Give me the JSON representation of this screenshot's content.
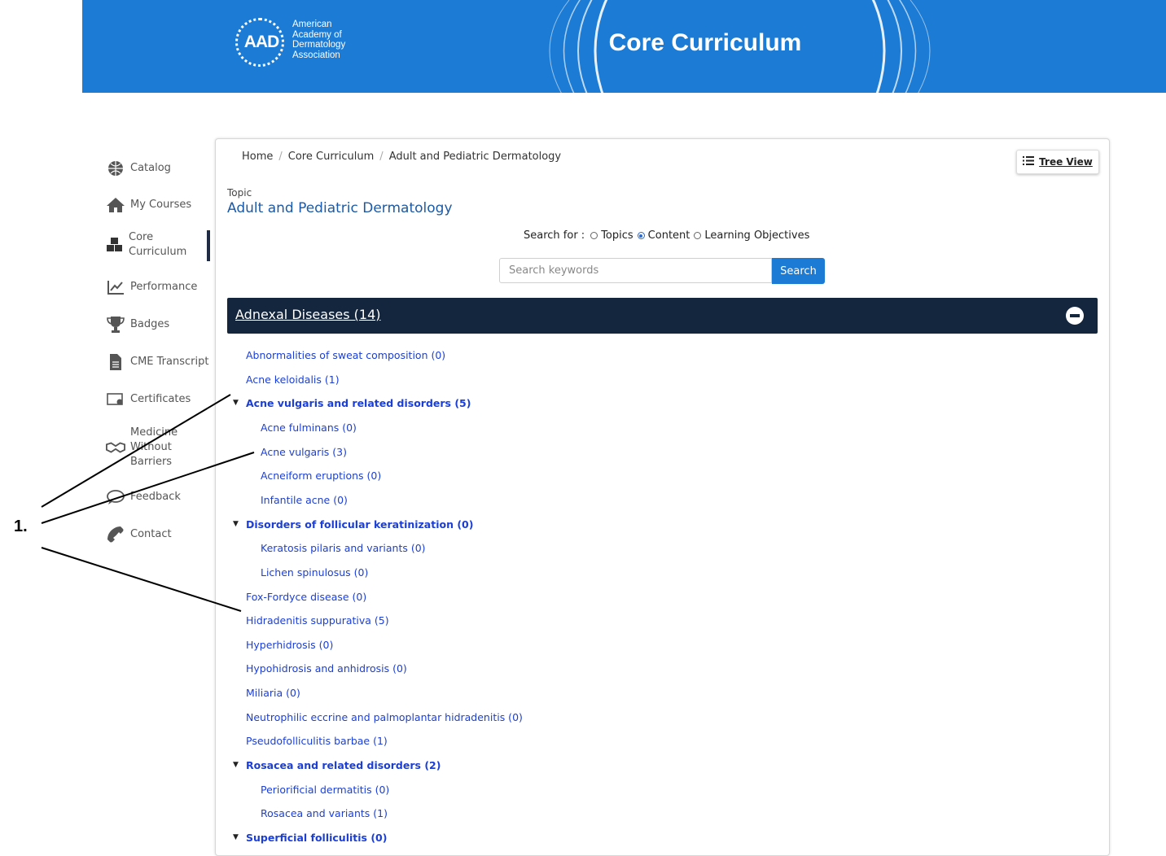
{
  "banner": {
    "logo_mark": "AAD",
    "logo_lines": [
      "American",
      "Academy of",
      "Dermatology",
      "Association"
    ],
    "title": "Core Curriculum"
  },
  "sidebar": {
    "items": [
      {
        "label": "Catalog",
        "icon": "globe-icon"
      },
      {
        "label": "My Courses",
        "icon": "home-icon"
      },
      {
        "label": "Core Curriculum",
        "icon": "cubes-icon"
      },
      {
        "label": "Performance",
        "icon": "chart-icon"
      },
      {
        "label": "Badges",
        "icon": "trophy-icon"
      },
      {
        "label": "CME Transcript",
        "icon": "document-icon"
      },
      {
        "label": "Certificates",
        "icon": "certificate-icon"
      },
      {
        "label": "Medicine Without Barriers",
        "icon": "handshake-icon"
      },
      {
        "label": "Feedback",
        "icon": "comment-icon"
      },
      {
        "label": "Contact",
        "icon": "phone-icon"
      }
    ],
    "active_index": 2
  },
  "breadcrumb": [
    "Home",
    "Core Curriculum",
    "Adult and Pediatric Dermatology"
  ],
  "tree_view_label": "Tree View",
  "topic": {
    "label": "Topic",
    "title": "Adult and Pediatric Dermatology"
  },
  "search": {
    "search_for_label": "Search for :",
    "options": [
      "Topics",
      "Content",
      "Learning Objectives"
    ],
    "selected": "Content",
    "placeholder": "Search keywords",
    "button_label": "Search"
  },
  "section": {
    "title": "Adnexal Diseases (14)"
  },
  "tree": [
    {
      "label": "Abnormalities of sweat composition (0)",
      "level": 0,
      "bold": false
    },
    {
      "label": "Acne keloidalis (1)",
      "level": 0,
      "bold": false
    },
    {
      "label": "Acne vulgaris and related disorders (5)",
      "level": 0,
      "bold": true
    },
    {
      "label": "Acne fulminans (0)",
      "level": 1,
      "bold": false
    },
    {
      "label": "Acne vulgaris (3)",
      "level": 1,
      "bold": false
    },
    {
      "label": "Acneiform eruptions (0)",
      "level": 1,
      "bold": false
    },
    {
      "label": "Infantile acne (0)",
      "level": 1,
      "bold": false
    },
    {
      "label": "Disorders of follicular keratinization (0)",
      "level": 0,
      "bold": true
    },
    {
      "label": "Keratosis pilaris and variants (0)",
      "level": 1,
      "bold": false
    },
    {
      "label": "Lichen spinulosus (0)",
      "level": 1,
      "bold": false
    },
    {
      "label": "Fox-Fordyce disease (0)",
      "level": 0,
      "bold": false
    },
    {
      "label": "Hidradenitis suppurativa (5)",
      "level": 0,
      "bold": false
    },
    {
      "label": "Hyperhidrosis (0)",
      "level": 0,
      "bold": false
    },
    {
      "label": "Hypohidrosis and anhidrosis (0)",
      "level": 0,
      "bold": false
    },
    {
      "label": "Miliaria (0)",
      "level": 0,
      "bold": false
    },
    {
      "label": "Neutrophilic eccrine and palmoplantar hidradenitis (0)",
      "level": 0,
      "bold": false
    },
    {
      "label": "Pseudofolliculitis barbae (1)",
      "level": 0,
      "bold": false
    },
    {
      "label": "Rosacea and related disorders (2)",
      "level": 0,
      "bold": true
    },
    {
      "label": "Periorificial dermatitis (0)",
      "level": 1,
      "bold": false
    },
    {
      "label": "Rosacea and variants (1)",
      "level": 1,
      "bold": false
    },
    {
      "label": "Superficial folliculitis (0)",
      "level": 0,
      "bold": true
    }
  ],
  "callout": {
    "number": "1."
  },
  "colors": {
    "banner": "#1c7bd4",
    "section_bar": "#13263d",
    "link": "#1b3fd6",
    "topic_title": "#1b5aa8"
  }
}
